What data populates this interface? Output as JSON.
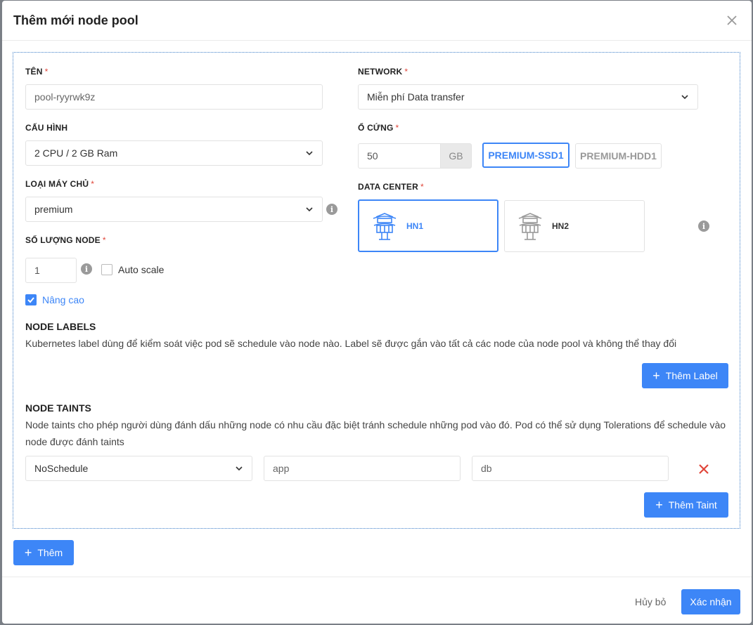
{
  "modal": {
    "title": "Thêm mới node pool"
  },
  "form": {
    "name": {
      "label": "TÊN",
      "required": "*",
      "value": "pool-ryyrwk9z"
    },
    "network": {
      "label": "NETWORK",
      "required": "*",
      "value": "Miễn phí Data transfer"
    },
    "config": {
      "label": "CẤU HÌNH",
      "value": "2 CPU / 2 GB Ram"
    },
    "disk": {
      "label": "Ổ CỨNG",
      "required": "*",
      "value": "50",
      "unit": "GB",
      "options": [
        "PREMIUM-SSD1",
        "PREMIUM-HDD1"
      ],
      "selected": "PREMIUM-SSD1"
    },
    "server_type": {
      "label": "LOẠI MÁY CHỦ",
      "required": "*",
      "value": "premium"
    },
    "data_center": {
      "label": "DATA CENTER",
      "required": "*",
      "options": [
        "HN1",
        "HN2"
      ],
      "selected": "HN1"
    },
    "node_count": {
      "label": "SỐ LƯỢNG NODE",
      "required": "*",
      "value": "1"
    },
    "auto_scale": {
      "label": "Auto scale",
      "checked": false
    },
    "advanced": {
      "label": "Nâng cao",
      "checked": true
    }
  },
  "node_labels": {
    "heading": "NODE LABELS",
    "description": "Kubernetes label dùng để kiểm soát việc pod sẽ schedule vào node nào. Label sẽ được gắn vào tất cả các node của node pool và không thể thay đổi",
    "add_button": "Thêm Label"
  },
  "node_taints": {
    "heading": "NODE TAINTS",
    "description": "Node taints cho phép người dùng đánh dấu những node có nhu cầu đặc biệt tránh schedule những pod vào đó. Pod có thể sử dụng Tolerations để schedule vào node được đánh taints",
    "rows": [
      {
        "effect": "NoSchedule",
        "key": "app",
        "value": "db"
      }
    ],
    "add_button": "Thêm Taint"
  },
  "add_pool_button": "Thêm",
  "footer": {
    "cancel": "Hủy bỏ",
    "confirm": "Xác nhận"
  },
  "colors": {
    "primary": "#3d86f7",
    "danger": "#e0463a"
  }
}
